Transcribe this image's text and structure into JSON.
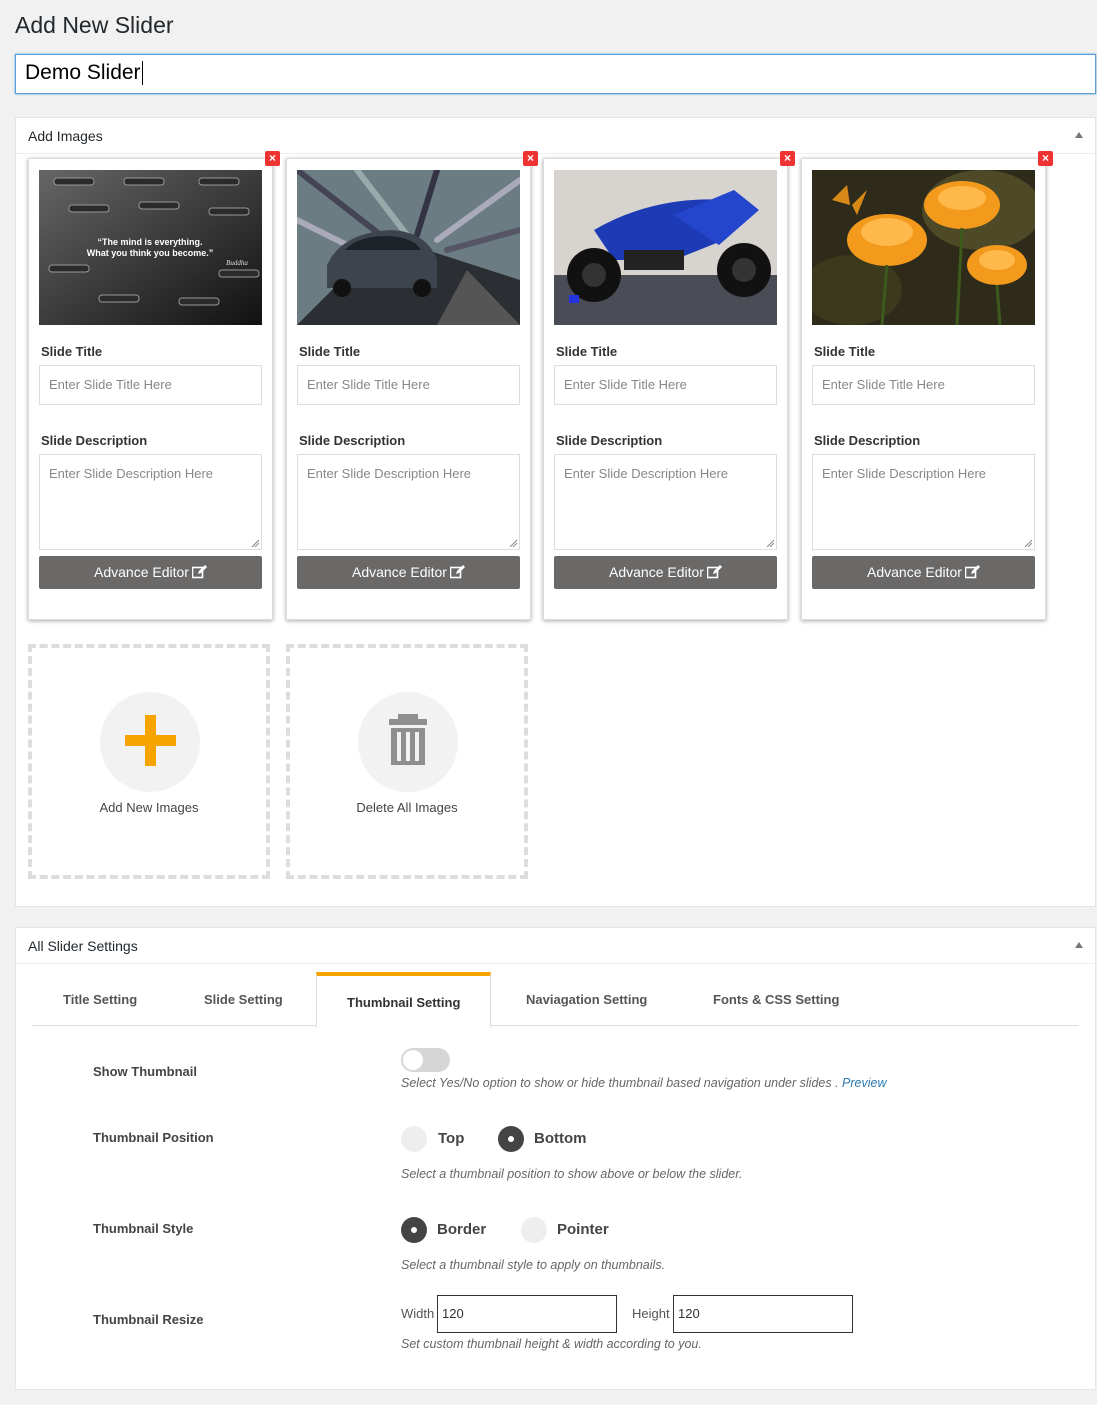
{
  "page": {
    "title": "Add New Slider",
    "slider_name": "Demo Slider"
  },
  "images_box": {
    "heading": "Add Images",
    "slides": [
      {
        "thumb": "quote-image",
        "title_label": "Slide Title",
        "title_placeholder": "Enter Slide Title Here",
        "desc_label": "Slide Description",
        "desc_placeholder": "Enter Slide Description Here",
        "editor_label": "Advance Editor",
        "quote": "\"The mind is everything. What you think you become.\"",
        "author": "Buddha"
      },
      {
        "thumb": "car-image",
        "title_label": "Slide Title",
        "title_placeholder": "Enter Slide Title Here",
        "desc_label": "Slide Description",
        "desc_placeholder": "Enter Slide Description Here",
        "editor_label": "Advance Editor"
      },
      {
        "thumb": "motorcycle-image",
        "title_label": "Slide Title",
        "title_placeholder": "Enter Slide Title Here",
        "desc_label": "Slide Description",
        "desc_placeholder": "Enter Slide Description Here",
        "editor_label": "Advance Editor"
      },
      {
        "thumb": "flower-image",
        "title_label": "Slide Title",
        "title_placeholder": "Enter Slide Title Here",
        "desc_label": "Slide Description",
        "desc_placeholder": "Enter Slide Description Here",
        "editor_label": "Advance Editor"
      }
    ],
    "add_label": "Add New Images",
    "delete_label": "Delete All Images"
  },
  "settings_box": {
    "heading": "All Slider Settings",
    "tabs": [
      "Title Setting",
      "Slide Setting",
      "Thumbnail Setting",
      "Naviagation Setting",
      "Fonts & CSS Setting"
    ],
    "active_tab": "Thumbnail Setting",
    "show_thumbnail": {
      "label": "Show Thumbnail",
      "enabled": false,
      "help": "Select Yes/No option to show or hide thumbnail based navigation under slides .",
      "link": "Preview"
    },
    "position": {
      "label": "Thumbnail Position",
      "options": [
        "Top",
        "Bottom"
      ],
      "selected": "Bottom",
      "help": "Select a thumbnail position to show above or below the slider."
    },
    "style": {
      "label": "Thumbnail Style",
      "options": [
        "Border",
        "Pointer"
      ],
      "selected": "Border",
      "help": "Select a thumbnail style to apply on thumbnails."
    },
    "resize": {
      "label": "Thumbnail Resize",
      "width_label": "Width",
      "width_value": "120",
      "height_label": "Height",
      "height_value": "120",
      "help": "Set custom thumbnail height & width according to you."
    }
  },
  "colors": {
    "accent": "#f7a400",
    "close": "#e33333",
    "button": "#6b6868"
  }
}
